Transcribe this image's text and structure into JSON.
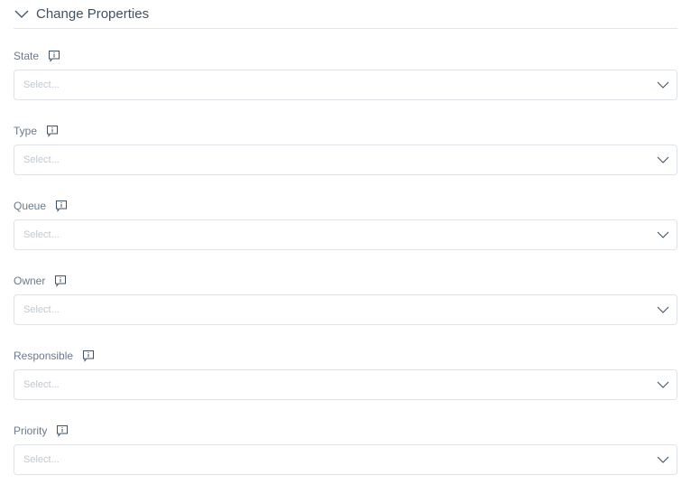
{
  "section": {
    "title": "Change Properties",
    "toggle_icon": "chevron-down-icon"
  },
  "fields": [
    {
      "label": "State",
      "placeholder": "Select...",
      "info_icon": "info-tooltip-icon"
    },
    {
      "label": "Type",
      "placeholder": "Select...",
      "info_icon": "info-tooltip-icon"
    },
    {
      "label": "Queue",
      "placeholder": "Select...",
      "info_icon": "info-tooltip-icon"
    },
    {
      "label": "Owner",
      "placeholder": "Select...",
      "info_icon": "info-tooltip-icon"
    },
    {
      "label": "Responsible",
      "placeholder": "Select...",
      "info_icon": "info-tooltip-icon"
    },
    {
      "label": "Priority",
      "placeholder": "Select...",
      "info_icon": "info-tooltip-icon"
    }
  ]
}
